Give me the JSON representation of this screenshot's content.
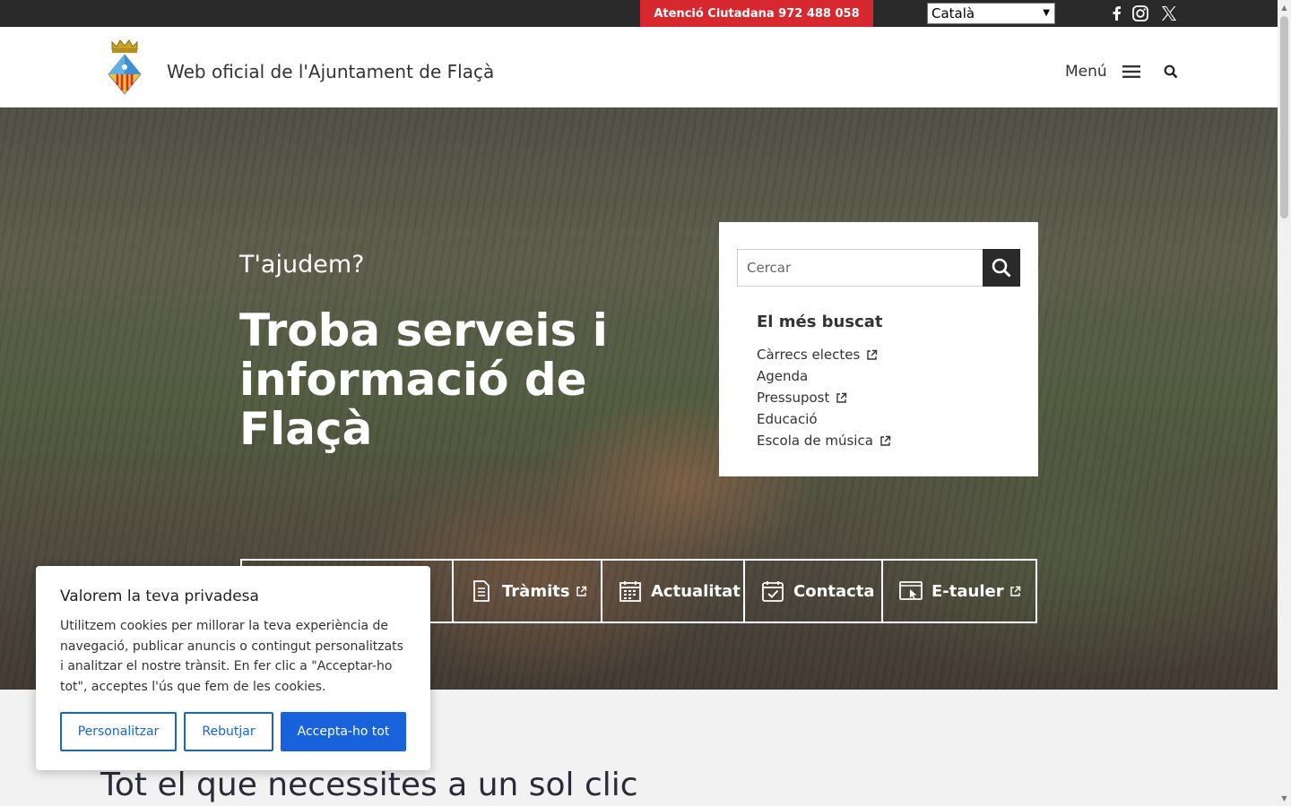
{
  "topbar": {
    "atencio_label": "Atenció Ciutadana 972 488 058",
    "language_selected": "Català",
    "social": [
      "facebook-icon",
      "instagram-icon",
      "x-icon"
    ]
  },
  "header": {
    "site_title": "Web oficial de l'Ajuntament de Flaçà",
    "menu_label": "Menú"
  },
  "hero": {
    "kicker": "T'ajudem?",
    "title": "Troba serveis i informació de Flaçà"
  },
  "search_panel": {
    "placeholder": "Cercar",
    "heading": "El més buscat",
    "links": [
      {
        "label": "Càrrecs electes",
        "external": true
      },
      {
        "label": "Agenda",
        "external": false
      },
      {
        "label": "Pressupost",
        "external": true
      },
      {
        "label": "Educació",
        "external": false
      },
      {
        "label": "Escola de música",
        "external": true
      }
    ]
  },
  "actions": [
    {
      "label": "",
      "icon": "hidden-icon"
    },
    {
      "label": "Tràmits",
      "icon": "document-icon",
      "external": true
    },
    {
      "label": "Actualitat",
      "icon": "calendar-grid-icon",
      "external": false
    },
    {
      "label": "Contacta",
      "icon": "calendar-check-icon",
      "external": false
    },
    {
      "label": "E-tauler",
      "icon": "screen-pointer-icon",
      "external": true
    }
  ],
  "bottom_heading": "Tot el que necessites a un sol clic",
  "cookie": {
    "title": "Valorem la teva privadesa",
    "text": "Utilitzem cookies per millorar la teva experiència de navegació, publicar anuncis o contingut personalitzats i analitzar el nostre trànsit. En fer clic a \"Acceptar-ho tot\", acceptes l'ús que fem de les cookies.",
    "customize": "Personalitzar",
    "reject": "Rebutjar",
    "accept": "Accepta-ho tot"
  },
  "colors": {
    "atencio_bg": "#d7282f",
    "accent_blue": "#1863dc",
    "topbar_bg": "#2a2a2a"
  }
}
